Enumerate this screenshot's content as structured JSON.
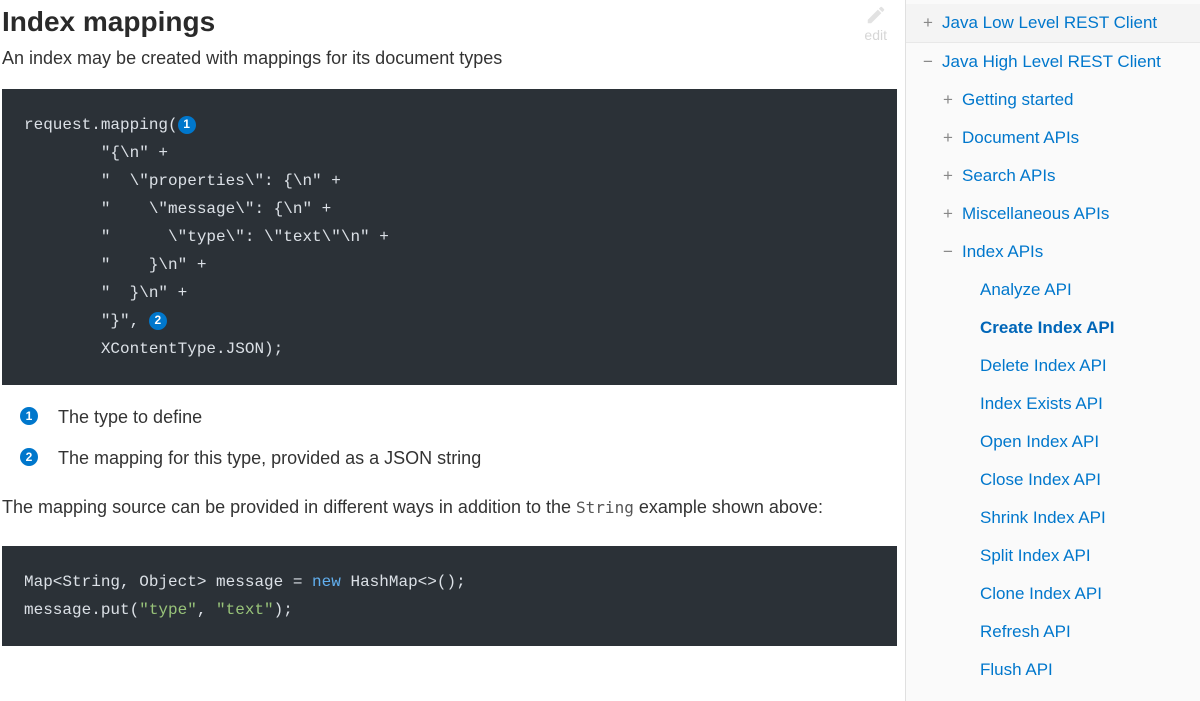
{
  "heading": "Index mappings",
  "edit_label": "edit",
  "intro": "An index may be created with mappings for its document types",
  "code1": {
    "l1a": "request.mapping(",
    "l2": "        \"{\\n\" +",
    "l3": "        \"  \\\"properties\\\": {\\n\" +",
    "l4": "        \"    \\\"message\\\": {\\n\" +",
    "l5": "        \"      \\\"type\\\": \\\"text\\\"\\n\" +",
    "l6": "        \"    }\\n\" +",
    "l7": "        \"  }\\n\" +",
    "l8": "        \"}\", ",
    "l9": "        XContentType.JSON);"
  },
  "callouts": [
    {
      "n": "1",
      "text": "The type to define"
    },
    {
      "n": "2",
      "text": "The mapping for this type, provided as a JSON string"
    }
  ],
  "para2_a": "The mapping source can be provided in different ways in addition to the ",
  "para2_code": "String",
  "para2_b": " example shown above:",
  "code2": {
    "l1a": "Map<String, Object> message = ",
    "l1kw": "new",
    "l1b": " HashMap<>();",
    "l2a": "message.put(",
    "l2s1": "\"type\"",
    "l2m": ", ",
    "l2s2": "\"text\"",
    "l2b": ");"
  },
  "nav": {
    "top1": "Java Low Level REST Client",
    "top2": "Java High Level REST Client",
    "l2": [
      "Getting started",
      "Document APIs",
      "Search APIs",
      "Miscellaneous APIs",
      "Index APIs"
    ],
    "l3": [
      "Analyze API",
      "Create Index API",
      "Delete Index API",
      "Index Exists API",
      "Open Index API",
      "Close Index API",
      "Shrink Index API",
      "Split Index API",
      "Clone Index API",
      "Refresh API",
      "Flush API"
    ],
    "active_l3": "Create Index API"
  }
}
